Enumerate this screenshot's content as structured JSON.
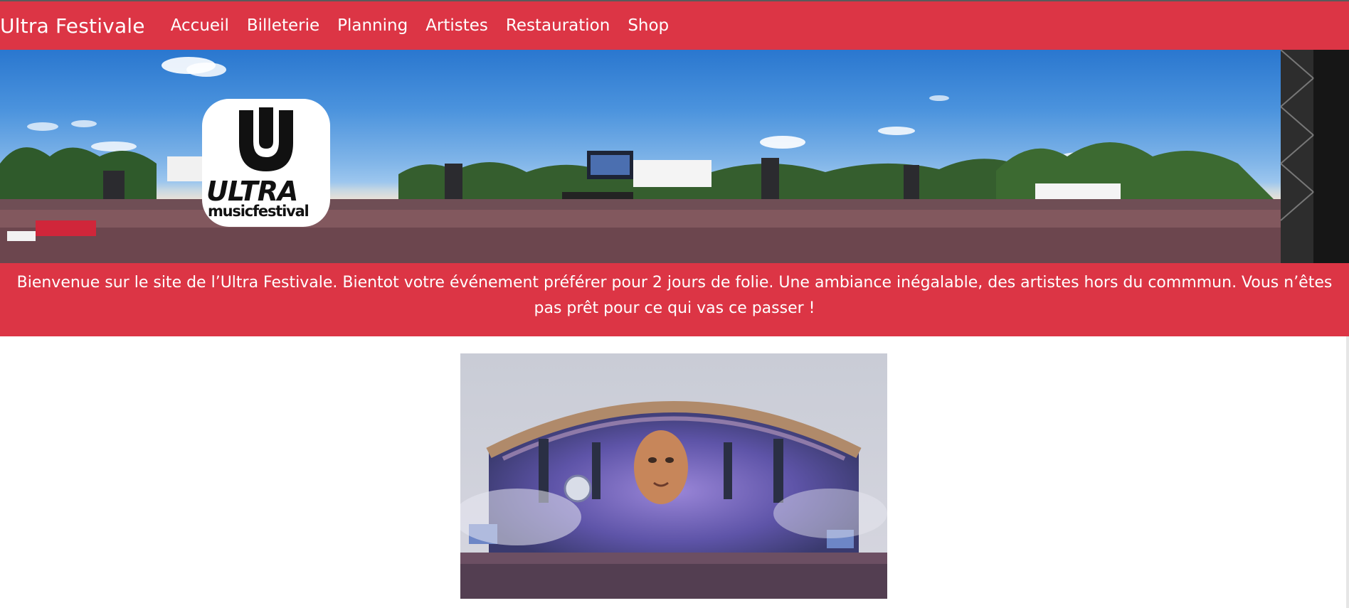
{
  "navbar": {
    "brand": "Ultra Festivale",
    "links": [
      "Accueil",
      "Billeterie",
      "Planning",
      "Artistes",
      "Restauration",
      "Shop"
    ],
    "background": "#dc3545"
  },
  "hero": {
    "description": "",
    "logo": {
      "word": "ULTRA",
      "sub": "musicfestival"
    }
  },
  "welcome": {
    "text": "Bienvenue sur le site de l’Ultra Festivale. Bientot votre événement préférer pour 2 jours de folie. Une ambiance inégalable, des artistes hors du commmun. Vous n’êtes pas prêt pour ce qui vas ce passer !"
  },
  "colors": {
    "accent": "#dc3545",
    "text_on_accent": "#ffffff"
  }
}
